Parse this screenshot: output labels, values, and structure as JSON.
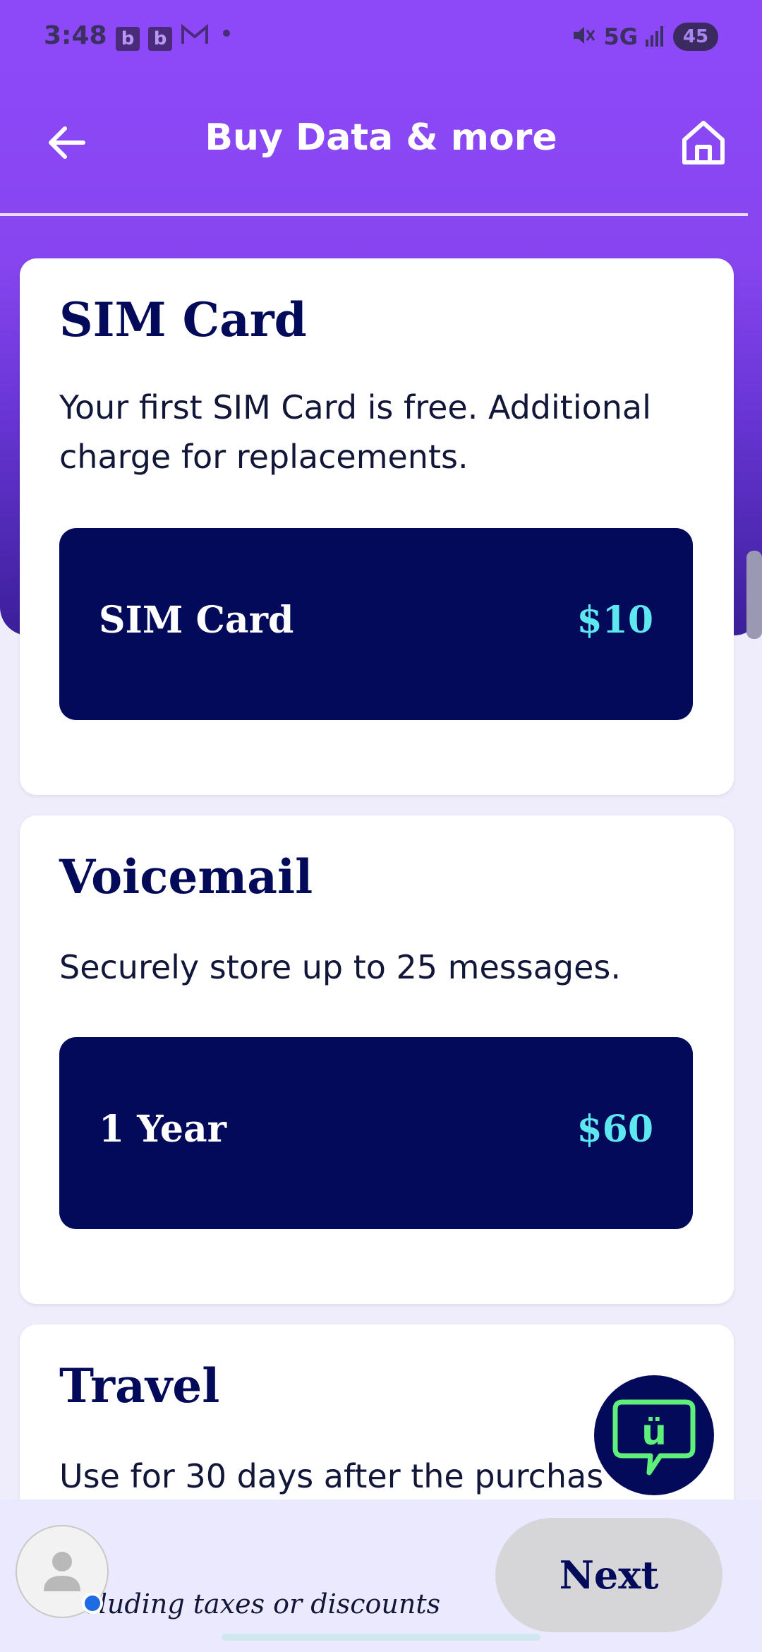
{
  "status_bar": {
    "time": "3:48",
    "notif_1": "b",
    "notif_2": "b",
    "gmail_icon": "gmail-icon",
    "network": "5G",
    "battery": "45"
  },
  "header": {
    "title": "Buy Data & more",
    "back_icon": "arrow-left-icon",
    "home_icon": "home-icon"
  },
  "sections": [
    {
      "title": "SIM Card",
      "description": "Your first SIM Card is free. Additional charge for replacements.",
      "option": {
        "label": "SIM Card",
        "price": "$10"
      }
    },
    {
      "title": "Voicemail",
      "description": "Securely store up to 25 messages.",
      "option": {
        "label": "1 Year",
        "price": "$60"
      }
    },
    {
      "title": "Travel",
      "description": "Use for 30 days after the purchas"
    }
  ],
  "chat": {
    "icon": "chat-bubble-icon",
    "glyph": "ü"
  },
  "footer": {
    "note": "…ncluding taxes or discounts",
    "next_label": "Next"
  },
  "colors": {
    "brand_purple": "#8d48f7",
    "navy": "#030a5a",
    "price_cyan": "#5de8f0",
    "chat_green": "#5ef07a"
  }
}
